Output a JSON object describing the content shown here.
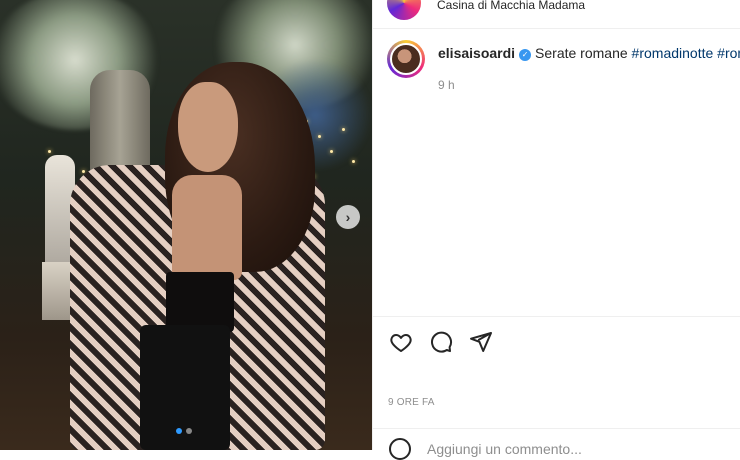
{
  "post": {
    "location": "Casina di Macchia Madama",
    "username": "elisaisoardi",
    "caption_text": "Serate romane",
    "hashtags": [
      "#romadinotte",
      "#rom"
    ],
    "caption_time": "9 h",
    "post_time": "9 ORE FA",
    "carousel_dots": 2,
    "carousel_active": 0
  },
  "comment": {
    "placeholder": "Aggiungi un commento..."
  },
  "icons": {
    "verified": "verified-badge-icon",
    "like": "heart-icon",
    "comment": "comment-bubble-icon",
    "share": "paper-plane-icon",
    "next": "chevron-right-icon",
    "emoji": "emoji-icon"
  },
  "colors": {
    "hashtag": "#00376b",
    "muted": "#8e8e8e",
    "verified": "#3897f0",
    "carousel_active": "#2f9bff"
  }
}
